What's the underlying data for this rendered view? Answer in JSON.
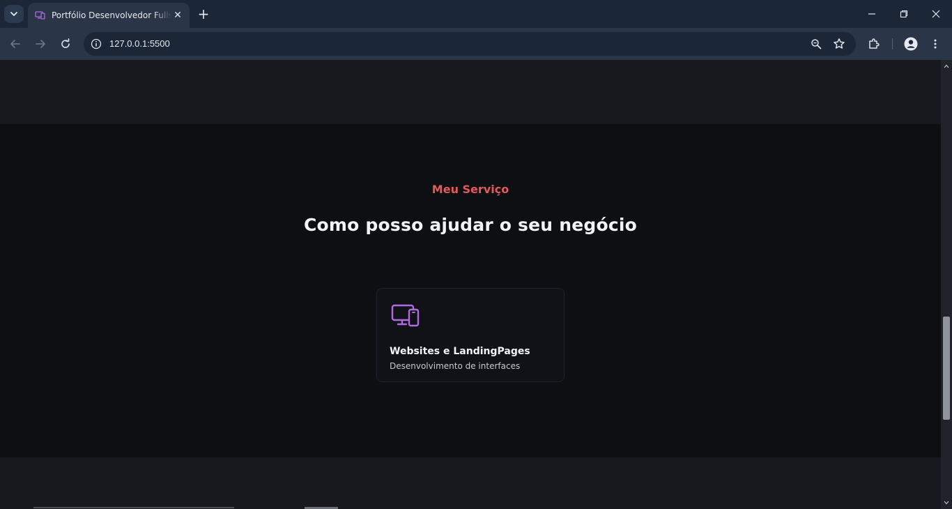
{
  "browser": {
    "tab_title": "Portfólio Desenvolvedor Fullstack",
    "tab_close": "✕",
    "new_tab": "+",
    "url": "127.0.0.1:5500"
  },
  "page": {
    "services": {
      "kicker": "Meu Serviço",
      "title": "Como posso ajudar o seu negócio",
      "cards": [
        {
          "icon": "devices-icon",
          "title": "Websites e LandingPages",
          "description": "Desenvolvimento de interfaces"
        }
      ]
    }
  },
  "colors": {
    "accent_red": "#e45a5a",
    "accent_purple": "#b06be0",
    "section_bg": "#0d0f13",
    "page_bg": "#18191e"
  }
}
